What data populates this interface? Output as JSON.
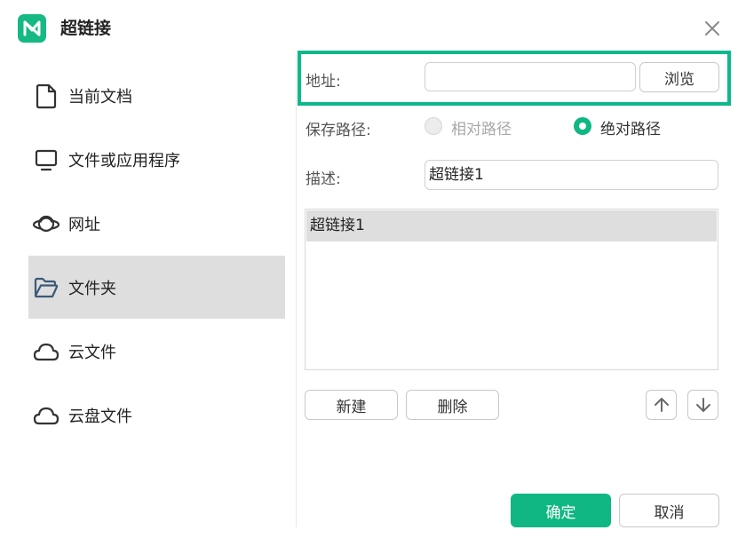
{
  "dialog": {
    "title": "超链接",
    "close_icon": "close-icon",
    "logo_icon": "app-logo-icon"
  },
  "sidebar": {
    "items": [
      {
        "label": "当前文档",
        "icon": "document-icon",
        "active": false
      },
      {
        "label": "文件或应用程序",
        "icon": "monitor-icon",
        "active": false
      },
      {
        "label": "网址",
        "icon": "planet-icon",
        "active": false
      },
      {
        "label": "文件夹",
        "icon": "folder-icon",
        "active": true
      },
      {
        "label": "云文件",
        "icon": "cloud-icon",
        "active": false
      },
      {
        "label": "云盘文件",
        "icon": "cloud-drive-icon",
        "active": false
      }
    ]
  },
  "address": {
    "label": "地址:",
    "value": "",
    "browse_label": "浏览"
  },
  "save_path": {
    "label": "保存路径:",
    "options": [
      {
        "label": "相对路径",
        "checked": false,
        "disabled": true
      },
      {
        "label": "绝对路径",
        "checked": true,
        "disabled": false
      }
    ]
  },
  "description": {
    "label": "描述:",
    "value": "超链接1"
  },
  "links_list": {
    "items": [
      "超链接1"
    ]
  },
  "list_actions": {
    "new_label": "新建",
    "delete_label": "删除",
    "move_up_icon": "arrow-up-icon",
    "move_down_icon": "arrow-down-icon"
  },
  "footer": {
    "confirm_label": "确定",
    "cancel_label": "取消"
  },
  "colors": {
    "accent": "#10b782",
    "highlight_frame": "#0fb88a",
    "active_item_bg": "#dedede",
    "folder_icon": "#3b5a78"
  }
}
